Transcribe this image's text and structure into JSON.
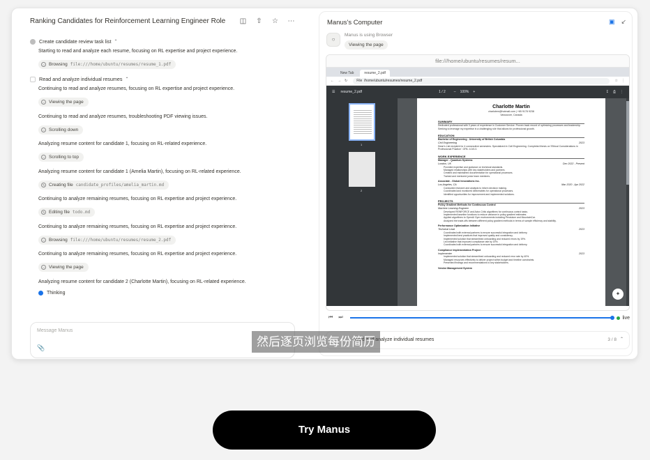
{
  "task": {
    "title": "Ranking Candidates for Reinforcement Learning Engineer Role",
    "icons": [
      "file-icon",
      "share-icon",
      "star-icon",
      "more-icon"
    ]
  },
  "feed": {
    "step1": {
      "label": "Create candidate review task list",
      "status": "done"
    },
    "msg1": "Starting to read and analyze each resume, focusing on RL expertise and project experience.",
    "chip1": {
      "action": "Browsing",
      "target": "file:///home/ubuntu/resumes/resume_1.pdf"
    },
    "step2": {
      "label": "Read and analyze individual resumes",
      "status": "in-progress"
    },
    "msg2": "Continuing to read and analyze resumes, focusing on RL expertise and project experience.",
    "chip2": {
      "action": "Viewing the page"
    },
    "msg3": "Continuing to read and analyze resumes, troubleshooting PDF viewing issues.",
    "chip3": {
      "action": "Scrolling down"
    },
    "msg4": "Analyzing resume content for candidate 1, focusing on RL-related experience.",
    "chip4": {
      "action": "Scrolling to top"
    },
    "msg5": "Analyzing resume content for candidate 1 (Amelia Martin), focusing on RL-related experience.",
    "chip5": {
      "action": "Creating file",
      "target": "candidate_profiles/amelia_martin.md"
    },
    "msg6": "Continuing to analyze remaining resumes, focusing on RL expertise and project experience.",
    "chip6": {
      "action": "Editing file",
      "target": "todo.md"
    },
    "msg7": "Continuing to analyze remaining resumes, focusing on RL expertise and project experience.",
    "chip7": {
      "action": "Browsing",
      "target": "file:///home/ubuntu/resumes/resume_2.pdf"
    },
    "msg8": "Continuing to analyze remaining resumes, focusing on RL expertise and project experience.",
    "chip8": {
      "action": "Viewing the page"
    },
    "msg9": "Analyzing resume content for candidate 2 (Charlotte Martin), focusing on RL-related experience.",
    "thinking": "Thinking"
  },
  "composer": {
    "placeholder": "Message Manus"
  },
  "computer": {
    "title": "Manus's Computer",
    "using_text": "Manus is using Browser",
    "using_action": "Viewing the page",
    "url": "file:///home/ubuntu/resumes/resum...",
    "tabs": [
      "New Tab",
      "resume_2.pdf"
    ],
    "omnibox": "/home/ubuntu/resumes/resume_2.pdf",
    "omni_prefix": "File",
    "pdf_name": "resume_2.pdf",
    "pdf_page": "1 / 2",
    "pdf_zoom": "100%",
    "thumb_labels": [
      "1",
      "2"
    ],
    "live_label": "live"
  },
  "resume": {
    "name": "Charlotte Martin",
    "contact": "charlotem@hotmail.com | +65 9178 9238",
    "location": "Vancouver, Canada",
    "summary_h": "SUMMARY",
    "summary": "Dedicated professional with 3 years of experience in Customer Service. Proven track record of optimizing processes and leadership. Seeking to leverage my expertise in a challenging role that allows for professional growth.",
    "education_h": "EDUCATION",
    "edu_school": "Bachelor of Engineering - University of British Columbia",
    "edu_field": "Civil Engineering",
    "edu_year": "2023",
    "edu_note": "Dean's List recipient for 4 consecutive semesters. Specialized in Civil Engineering. Completed thesis on 'Ethical Considerations in Professional Practice'. GPA: 4.0/4.0.",
    "work_h": "WORK EXPERIENCE",
    "job1_title": "Manager - Quantum Systems",
    "job1_loc": "London, UK",
    "job1_dates": "Dec 2022 - Present",
    "job1_b": [
      "Provided expertise and guidance on technical standards.",
      "Managed relationships with key stakeholders and partners.",
      "Created and maintained documentation for operational processes.",
      "Trained and mentored junior team members."
    ],
    "job2_title": "Associate - Global Innovations Inc.",
    "job2_loc": "Los Angeles, CA",
    "job2_dates": "Mar 2020 - Apr 2022",
    "job2_b": [
      "Conducted research and analysis to inform decision making.",
      "Coordinated and monitored deliverables for operational processes.",
      "Identified opportunities for improvement and implemented solutions."
    ],
    "projects_h": "PROJECTS",
    "p1_title": "Policy Gradient Methods for Continuous Control",
    "p1_role": "Machine Learning Engineer",
    "p1_year": "2023",
    "p1_b": [
      "Developed REINFORCE and Actor-Critic algorithms for continuous control tasks.",
      "Implemented baseline functions to reduce variance in policy gradient estimates.",
      "Applied algorithms to OpenAI Gym environments including Pendulum and MountainCar.",
      "Analyzed the trade-offs between different policy gradient methods in terms of sample efficiency and stability."
    ],
    "p2_title": "Performance Optimization Initiative",
    "p2_role": "Technical Lead",
    "p2_year": "2023",
    "p2_b": [
      "Coordinated with external partners to ensure successful integration and delivery.",
      "Implemented best practices that improved quality and consistency.",
      "Implemented solution that streamlined onboarding and reduced errors by 19%.",
      "Led initiative that improved compliance rate by 19%.",
      "Coordinated with external partners to ensure successful integration and delivery."
    ],
    "p3_title": "Compliance Implementation Project",
    "p3_role": "Implementer",
    "p3_year": "2023",
    "p3_b": [
      "Implemented solution that streamlined onboarding and reduced error rate by 40%.",
      "Managed resources effectively to deliver project within budget and timeline constraints.",
      "Presented findings and recommendations to key stakeholders."
    ],
    "p4_title": "Vendor Management System"
  },
  "progress": {
    "label": "Read and analyze individual resumes",
    "count": "3 / 8"
  },
  "subtitle": "然后逐页浏览每份简历",
  "cta": {
    "label": "Try Manus"
  },
  "colors": {
    "accent": "#1a73e8",
    "live": "#29a744",
    "cta_bg": "#000000"
  }
}
